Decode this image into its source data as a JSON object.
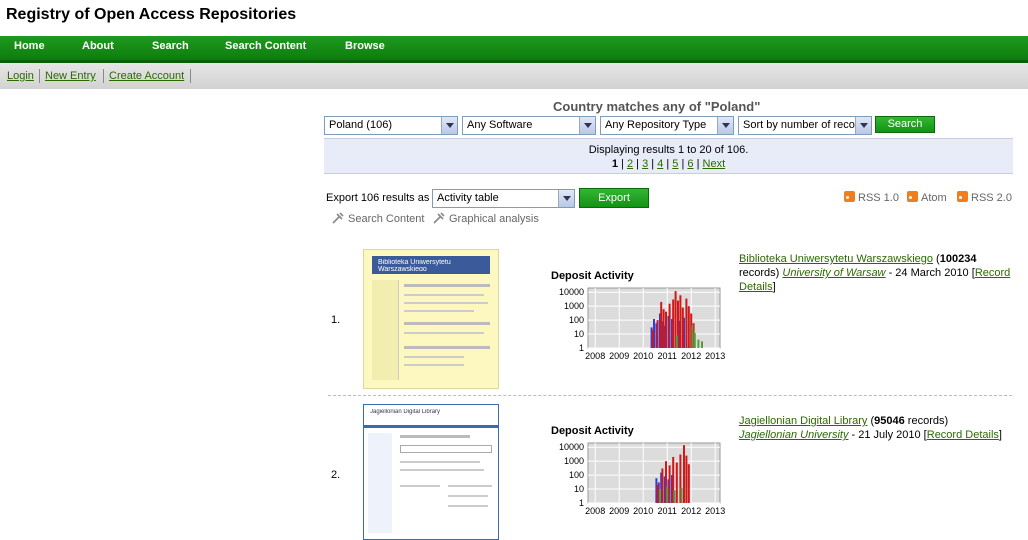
{
  "title": "Registry of Open Access Repositories",
  "nav": [
    "Home",
    "About",
    "Search",
    "Search Content",
    "Browse"
  ],
  "subnav": [
    "Login",
    "New Entry",
    "Create Account"
  ],
  "search": {
    "heading": "Country matches any of \"Poland\"",
    "country": "Poland (106)",
    "software": "Any Software",
    "repo_type": "Any Repository Type",
    "sort": "Sort by number of records",
    "button": "Search"
  },
  "results": {
    "summary": "Displaying results 1 to 20 of 106.",
    "pages": [
      "1",
      "2",
      "3",
      "4",
      "5",
      "6"
    ],
    "next": "Next"
  },
  "export": {
    "label": "Export 106 results as",
    "format": "Activity table",
    "button": "Export"
  },
  "tools": [
    "Search Content",
    "Graphical analysis"
  ],
  "feeds": [
    "RSS 1.0",
    "Atom",
    "RSS 2.0"
  ],
  "deposit_title": "Deposit Activity",
  "records": [
    {
      "index": "1.",
      "name": "Biblioteka Uniwersytetu Warszawskiego",
      "count": "100234",
      "records_word": "records)",
      "institution": "University of Warsaw",
      "date": "- 24 March 2010",
      "details": "Record Details",
      "thumb_text": "Biblioteka Uniwersytetu Warszawskiego"
    },
    {
      "index": "2.",
      "name": "Jagiellonian Digital Library",
      "count": "95046",
      "records_word": "records)",
      "institution": "Jagiellonian University",
      "date": "- 21 July 2010",
      "details": "Record Details",
      "thumb_text": "Jagiellonian Digital Library"
    }
  ],
  "chart_data": [
    {
      "type": "bar",
      "title": "Deposit Activity",
      "y_scale": "log",
      "ylim": [
        1,
        20000
      ],
      "y_ticks": [
        "1",
        "10",
        "100",
        "1000",
        "10000"
      ],
      "x_ticks": [
        "2008",
        "2009",
        "2010",
        "2011",
        "2012",
        "2013"
      ],
      "xlim": [
        2007.7,
        2013.2
      ],
      "grid": true,
      "series": [
        {
          "color": "#3a3ad0",
          "points": [
            [
              2010.35,
              30
            ],
            [
              2010.45,
              120
            ],
            [
              2010.55,
              60
            ],
            [
              2010.7,
              300
            ],
            [
              2010.8,
              80
            ],
            [
              2010.9,
              40
            ],
            [
              2011.05,
              200
            ],
            [
              2011.2,
              120
            ],
            [
              2011.5,
              90
            ],
            [
              2011.7,
              150
            ]
          ]
        },
        {
          "color": "#d01818",
          "points": [
            [
              2010.4,
              20
            ],
            [
              2010.6,
              100
            ],
            [
              2010.75,
              2000
            ],
            [
              2010.85,
              600
            ],
            [
              2010.95,
              400
            ],
            [
              2011.1,
              1500
            ],
            [
              2011.25,
              3000
            ],
            [
              2011.35,
              12000
            ],
            [
              2011.45,
              2500
            ],
            [
              2011.55,
              6000
            ],
            [
              2011.65,
              800
            ],
            [
              2011.8,
              3500
            ],
            [
              2011.9,
              1000
            ],
            [
              2012.0,
              300
            ],
            [
              2012.1,
              60
            ]
          ]
        },
        {
          "color": "#5a9a40",
          "points": [
            [
              2011.4,
              8
            ],
            [
              2012.05,
              40
            ],
            [
              2012.15,
              12
            ],
            [
              2012.3,
              4
            ],
            [
              2012.45,
              3
            ]
          ]
        }
      ]
    },
    {
      "type": "bar",
      "title": "Deposit Activity",
      "y_scale": "log",
      "ylim": [
        1,
        20000
      ],
      "y_ticks": [
        "1",
        "10",
        "100",
        "1000",
        "10000"
      ],
      "x_ticks": [
        "2008",
        "2009",
        "2010",
        "2011",
        "2012",
        "2013"
      ],
      "xlim": [
        2007.7,
        2013.2
      ],
      "grid": true,
      "series": [
        {
          "color": "#3a3ad0",
          "points": [
            [
              2010.55,
              60
            ],
            [
              2010.65,
              30
            ],
            [
              2010.75,
              150
            ],
            [
              2010.9,
              80
            ],
            [
              2011.05,
              50
            ],
            [
              2011.2,
              100
            ]
          ]
        },
        {
          "color": "#d01818",
          "points": [
            [
              2010.6,
              20
            ],
            [
              2010.8,
              300
            ],
            [
              2010.95,
              1000
            ],
            [
              2011.1,
              500
            ],
            [
              2011.25,
              2000
            ],
            [
              2011.4,
              800
            ],
            [
              2011.55,
              3000
            ],
            [
              2011.7,
              14000
            ],
            [
              2011.8,
              2500
            ],
            [
              2011.9,
              600
            ]
          ]
        },
        {
          "color": "#5a9a40",
          "points": [
            [
              2010.7,
              10
            ],
            [
              2011.0,
              15
            ],
            [
              2011.3,
              8
            ],
            [
              2011.6,
              12
            ]
          ]
        }
      ]
    }
  ]
}
